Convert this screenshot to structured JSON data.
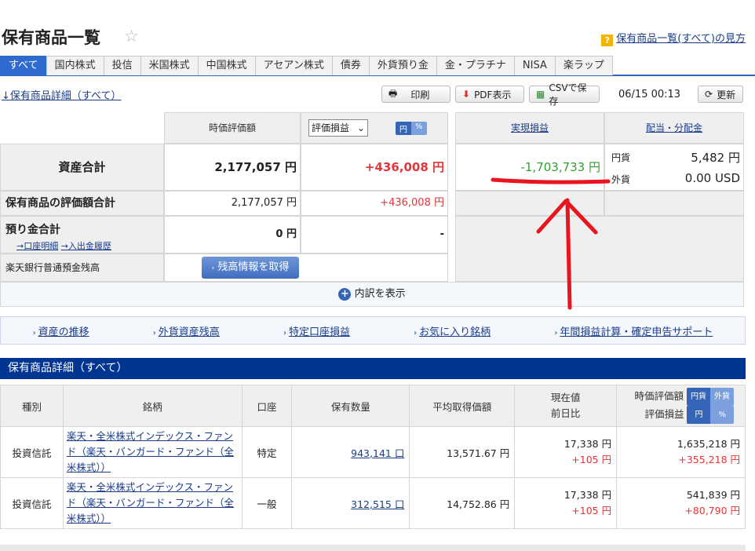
{
  "title": "保有商品一覧",
  "help_link": "保有商品一覧(すべて)の見方",
  "tabs": [
    "すべて",
    "国内株式",
    "投信",
    "米国株式",
    "中国株式",
    "アセアン株式",
    "債券",
    "外貨預り金",
    "金・プラチナ",
    "NISA",
    "楽ラップ"
  ],
  "detail_link": "↓保有商品詳細（すべて）",
  "toolbar": {
    "print": "印刷",
    "pdf": "PDF表示",
    "csv": "CSVで保存",
    "timestamp": "06/15 00:13",
    "refresh": "更新"
  },
  "summary": {
    "col_market_value": "時価評価額",
    "col_eval_select": "評価損益",
    "toggle_yen": "円",
    "toggle_pct": "%",
    "col_realized": "実現損益",
    "col_dividend": "配当・分配金",
    "total_label": "資産合計",
    "total_value": "2,177,057 円",
    "total_pl": "+436,008 円",
    "realized_value": "-1,703,733 円",
    "div_yen_label": "円貨",
    "div_yen_value": "5,482 円",
    "div_fx_label": "外貨",
    "div_fx_value": "0.00 USD",
    "holdings_label": "保有商品の評価額合計",
    "holdings_value": "2,177,057 円",
    "holdings_pl": "+436,008 円",
    "deposit_label": "預り金合計",
    "deposit_link1": "→口座明細",
    "deposit_link2": "→入出金履歴",
    "deposit_value": "0 円",
    "deposit_pl": "-",
    "bank_label": "楽天銀行普通預金残高",
    "bank_button": "残高情報を取得",
    "breakdown": "内訳を表示"
  },
  "banner_links": [
    "資産の推移",
    "外貨資産残高",
    "特定口座損益",
    "お気に入り銘柄",
    "年間損益計算・確定申告サポート"
  ],
  "section_title": "保有商品詳細（すべて）",
  "table": {
    "headers": {
      "type": "種別",
      "name": "銘柄",
      "account": "口座",
      "qty": "保有数量",
      "avg": "平均取得価額",
      "price_1": "現在値",
      "price_2": "前日比",
      "mv": "時価評価額",
      "pl": "評価損益",
      "pill_jpy": "円貨",
      "pill_fx": "外貨",
      "pill_yen": "円",
      "pill_pct": "%"
    },
    "rows": [
      {
        "type": "投資信託",
        "name": "楽天・全米株式インデックス・ファンド（楽天・バンガード・ファンド（全米株式））",
        "account": "特定",
        "qty": "943,141 口",
        "avg": "13,571.67 円",
        "price": "17,338 円",
        "change": "+105 円",
        "mv": "1,635,218 円",
        "pl": "+355,218 円"
      },
      {
        "type": "投資信託",
        "name": "楽天・全米株式インデックス・ファンド（楽天・バンガード・ファンド（全米株式））",
        "account": "一般",
        "qty": "312,515 口",
        "avg": "14,752.86 円",
        "price": "17,338 円",
        "change": "+105 円",
        "mv": "541,839 円",
        "pl": "+80,790 円"
      }
    ]
  },
  "colors": {
    "accent": "#2f6bcf",
    "section": "#003592",
    "positive": "#e0373a",
    "negative": "#2f9f2f",
    "annotation": "#e8141e"
  }
}
